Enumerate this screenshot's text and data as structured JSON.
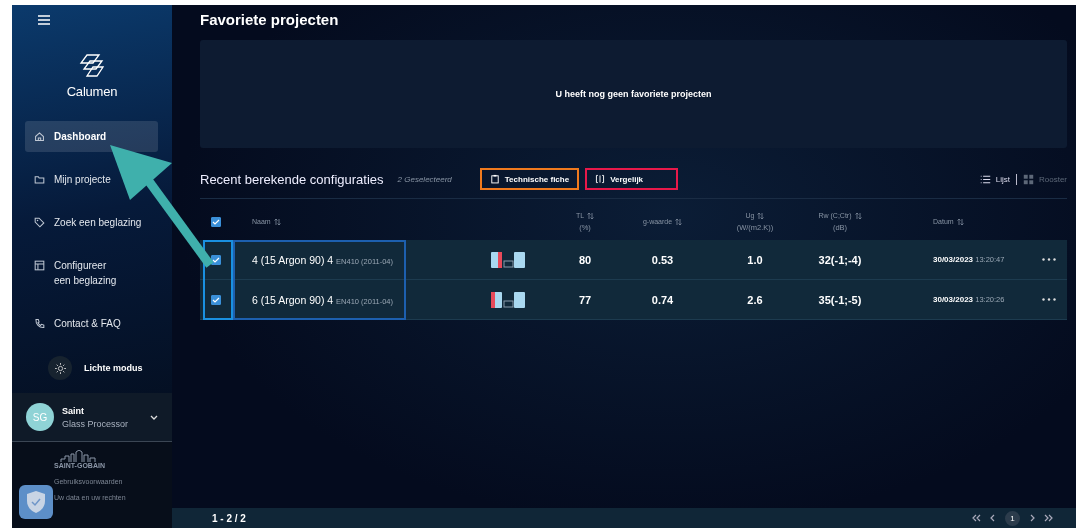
{
  "sidebar": {
    "brand": "Calumen",
    "items": [
      {
        "label": "Dashboard",
        "selected": true
      },
      {
        "label": "Mijn projecte",
        "selected": false
      },
      {
        "label": "Zoek een beglazing",
        "selected": false
      },
      {
        "label": "Configureer een beglazing",
        "selected": false
      },
      {
        "label": "Contact & FAQ",
        "selected": false
      }
    ],
    "theme_toggle": "Lichte modus",
    "user": {
      "initials": "SG",
      "name": "Saint",
      "role": "Glass Processor"
    },
    "company": "SAINT-GOBAIN",
    "links": [
      "Gebruiksvoorwaarden",
      "Uw data en uw rechten"
    ]
  },
  "favorites": {
    "title": "Favoriete projecten",
    "empty_message": "U heeft nog geen favoriete projecten"
  },
  "recent": {
    "title": "Recent berekende configuraties",
    "selection_count": "2 Geselecteerd",
    "actions": [
      {
        "label": "Technische fiche"
      },
      {
        "label": "Vergelijk"
      }
    ],
    "views": [
      {
        "label": "Lijst",
        "selected": true
      },
      {
        "label": "Rooster",
        "selected": false
      }
    ],
    "table": {
      "all_checked": true,
      "columns": [
        {
          "label": "Naam"
        },
        {
          "label": "TL",
          "unit": "(%)"
        },
        {
          "label": "g-waarde"
        },
        {
          "label": "Ug",
          "unit": "(W/(m2.K))"
        },
        {
          "label": "Rw (C;Ctr)",
          "unit": "(dB)"
        },
        {
          "label": "Datum"
        }
      ],
      "rows": [
        {
          "checked": true,
          "name": "4 (15 Argon 90) 4",
          "standard": "EN410 (2011-04)",
          "kind": "coated_inner",
          "tl": "80",
          "g": "0.53",
          "ug": "1.0",
          "rw": "32(-1;-4)",
          "date": "30/03/2023",
          "time": "13:20:47"
        },
        {
          "checked": true,
          "name": "6 (15 Argon 90) 4",
          "standard": "EN410 (2011-04)",
          "kind": "coated_outer",
          "tl": "77",
          "g": "0.74",
          "ug": "2.6",
          "rw": "35(-1;-5)",
          "date": "30/03/2023",
          "time": "13:20:26"
        }
      ]
    },
    "pagination": {
      "range": "1 - 2 / 2",
      "pages": [
        {
          "label": "1",
          "selected": true
        }
      ]
    }
  },
  "annotations": [
    {
      "kind": "arrow",
      "color": "#3fb0ac"
    },
    {
      "kind": "checkbox_frame",
      "color": "#1a90e0"
    },
    {
      "kind": "name_frame",
      "color": "#1d5fae"
    },
    {
      "kind": "button_frame",
      "color": "#f07a1e"
    },
    {
      "kind": "button_frame",
      "color": "#e8194a"
    }
  ]
}
